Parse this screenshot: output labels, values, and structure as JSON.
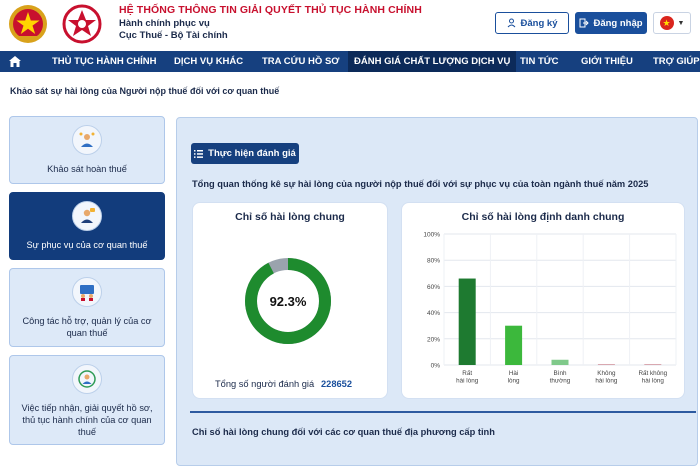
{
  "header": {
    "title": "HỆ THỐNG THÔNG TIN GIẢI QUYẾT THỦ TỤC HÀNH CHÍNH",
    "subtitle_1": "Hành chính phục vụ",
    "subtitle_2": "Cục Thuế - Bộ Tài chính",
    "register_label": "Đăng ký",
    "login_label": "Đăng nhập",
    "language_flag": "vietnam-flag-icon"
  },
  "nav": {
    "items": [
      {
        "label": "THỦ TỤC HÀNH CHÍNH",
        "active": false
      },
      {
        "label": "DỊCH VỤ KHÁC",
        "active": false
      },
      {
        "label": "TRA CỨU HỒ SƠ",
        "active": false
      },
      {
        "label": "ĐÁNH GIÁ CHẤT LƯỢNG DỊCH VỤ",
        "active": true
      },
      {
        "label": "TIN TỨC",
        "active": false
      },
      {
        "label": "GIỚI THIỆU",
        "active": false
      },
      {
        "label": "TRỢ GIÚP",
        "active": false
      }
    ]
  },
  "breadcrumb": "Khảo sát sự hài lòng của Người nộp thuế đối với cơ quan thuế",
  "sidebar": {
    "items": [
      {
        "label": "Khảo sát hoàn thuế",
        "icon": "refund-survey-icon",
        "active": false
      },
      {
        "label": "Sự phục vụ của cơ quan thuế",
        "icon": "service-officer-icon",
        "active": true
      },
      {
        "label": "Công tác hỗ trợ, quản lý của cơ quan thuế",
        "icon": "support-management-icon",
        "active": false
      },
      {
        "label": "Việc tiếp nhận, giải quyết hồ sơ, thủ tục hành chính của cơ quan thuế",
        "icon": "document-processing-icon",
        "active": false
      }
    ]
  },
  "main": {
    "evaluate_button": "Thực hiện đánh giá",
    "overview_title": "Tổng quan thống kê sự hài lòng của người nộp thuế đối với sự phục vụ của toàn ngành thuế năm 2025",
    "general_index": {
      "title": "Chỉ số hài lòng chung",
      "value_text": "92.3%",
      "value": 92.3,
      "total_label": "Tổng số người đánh giá",
      "total_value": "228652",
      "color_main": "#1e8b2e",
      "color_rest": "#9aa3ad"
    },
    "bottom_title": "Chỉ số hài lòng chung đối với các cơ quan thuế địa phương cấp tỉnh"
  },
  "chart_data": {
    "type": "bar",
    "title": "Chỉ số hài lòng định danh chung",
    "categories": [
      [
        "Rất",
        "hài lòng"
      ],
      [
        "Hài",
        "lòng"
      ],
      [
        "Bình",
        "thường"
      ],
      [
        "Không",
        "hài lòng"
      ],
      [
        "Rất không",
        "hài lòng"
      ]
    ],
    "values": [
      66,
      30,
      4,
      0.5,
      0.5
    ],
    "colors": [
      "#1e7a30",
      "#3cb83c",
      "#7fc98a",
      "#d9a8b0",
      "#d9a8b0"
    ],
    "yticks": [
      "0%",
      "20%",
      "40%",
      "60%",
      "80%",
      "100%"
    ],
    "ylim": [
      0,
      100
    ],
    "grid": true
  }
}
